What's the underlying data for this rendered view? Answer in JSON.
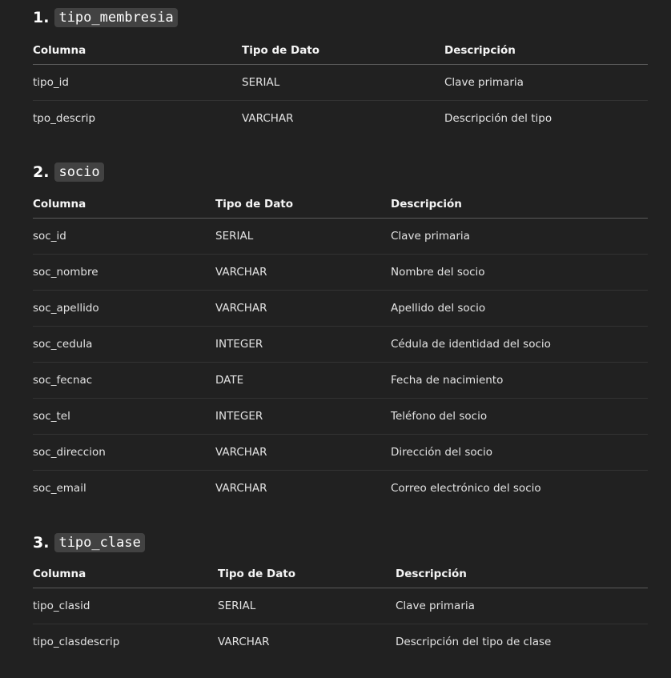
{
  "sections": [
    {
      "number": "1.",
      "name": "tipo_membresia",
      "headers": [
        "Columna",
        "Tipo de Dato",
        "Descripción"
      ],
      "rows": [
        [
          "tipo_id",
          "SERIAL",
          "Clave primaria"
        ],
        [
          "tpo_descrip",
          "VARCHAR",
          "Descripción del tipo"
        ]
      ]
    },
    {
      "number": "2.",
      "name": "socio",
      "headers": [
        "Columna",
        "Tipo de Dato",
        "Descripción"
      ],
      "rows": [
        [
          "soc_id",
          "SERIAL",
          "Clave primaria"
        ],
        [
          "soc_nombre",
          "VARCHAR",
          "Nombre del socio"
        ],
        [
          "soc_apellido",
          "VARCHAR",
          "Apellido del socio"
        ],
        [
          "soc_cedula",
          "INTEGER",
          "Cédula de identidad del socio"
        ],
        [
          "soc_fecnac",
          "DATE",
          "Fecha de nacimiento"
        ],
        [
          "soc_tel",
          "INTEGER",
          "Teléfono del socio"
        ],
        [
          "soc_direccion",
          "VARCHAR",
          "Dirección del socio"
        ],
        [
          "soc_email",
          "VARCHAR",
          "Correo electrónico del socio"
        ]
      ]
    },
    {
      "number": "3.",
      "name": "tipo_clase",
      "headers": [
        "Columna",
        "Tipo de Dato",
        "Descripción"
      ],
      "rows": [
        [
          "tipo_clasid",
          "SERIAL",
          "Clave primaria"
        ],
        [
          "tipo_clasdescrip",
          "VARCHAR",
          "Descripción del tipo de clase"
        ]
      ]
    }
  ]
}
